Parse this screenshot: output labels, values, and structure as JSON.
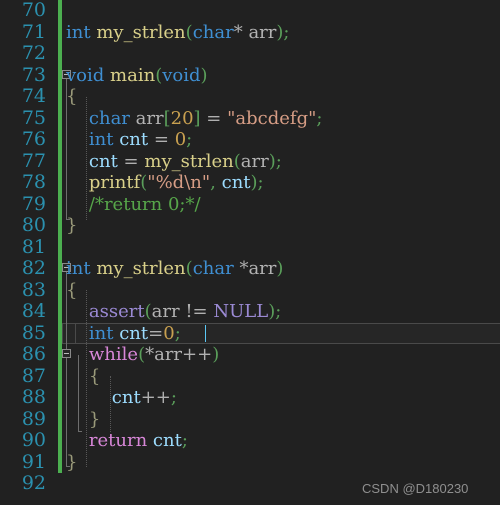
{
  "editor": {
    "background_color": "#212121",
    "gutter_color": "#212121",
    "line_number_color": "#2b91af",
    "change_bar_color": "#4caf50",
    "current_line": 85,
    "first_line": 70,
    "last_line": 92,
    "line_height": 21.5
  },
  "line_numbers": [
    "70",
    "71",
    "72",
    "73",
    "74",
    "75",
    "76",
    "77",
    "78",
    "79",
    "80",
    "81",
    "82",
    "83",
    "84",
    "85",
    "86",
    "87",
    "88",
    "89",
    "90",
    "91",
    "92"
  ],
  "code": [
    {
      "number": "70",
      "text": ""
    },
    {
      "number": "71",
      "text": "int my_strlen(char* arr);"
    },
    {
      "number": "72",
      "text": ""
    },
    {
      "number": "73",
      "text": "void main(void)"
    },
    {
      "number": "74",
      "text": "{"
    },
    {
      "number": "75",
      "text": "    char arr[20] = \"abcdefg\";"
    },
    {
      "number": "76",
      "text": "    int cnt = 0;"
    },
    {
      "number": "77",
      "text": "    cnt = my_strlen(arr);"
    },
    {
      "number": "78",
      "text": "    printf(\"%d\\n\", cnt);"
    },
    {
      "number": "79",
      "text": "    /*return 0;*/"
    },
    {
      "number": "80",
      "text": "}"
    },
    {
      "number": "81",
      "text": ""
    },
    {
      "number": "82",
      "text": "int my_strlen(char *arr)"
    },
    {
      "number": "83",
      "text": "{"
    },
    {
      "number": "84",
      "text": "    assert(arr != NULL);"
    },
    {
      "number": "85",
      "text": "    int cnt=0;"
    },
    {
      "number": "86",
      "text": "    while(*arr++)"
    },
    {
      "number": "87",
      "text": "    {"
    },
    {
      "number": "88",
      "text": "        cnt++;"
    },
    {
      "number": "89",
      "text": "    }"
    },
    {
      "number": "90",
      "text": "    return cnt;"
    },
    {
      "number": "91",
      "text": "}"
    },
    {
      "number": "92",
      "text": ""
    }
  ],
  "fold_markers": [
    {
      "line": "73",
      "state": "expanded"
    },
    {
      "line": "82",
      "state": "expanded"
    },
    {
      "line": "86",
      "state": "expanded"
    }
  ],
  "caret": {
    "line": "85",
    "after_text": "int cnt=0;"
  },
  "watermark": {
    "text": "CSDN @D180230"
  },
  "colors": {
    "keyword": "#3f8fd2",
    "function": "#d9d08a",
    "punctuation": "#5a9e5a",
    "variable": "#9cdcfe",
    "string": "#d69d85",
    "number": "#c8a050",
    "comment": "#57a64a",
    "control": "#d887d8",
    "macro": "#9b8ad4",
    "line_number": "#2b91af",
    "change_bar": "#4caf50"
  }
}
